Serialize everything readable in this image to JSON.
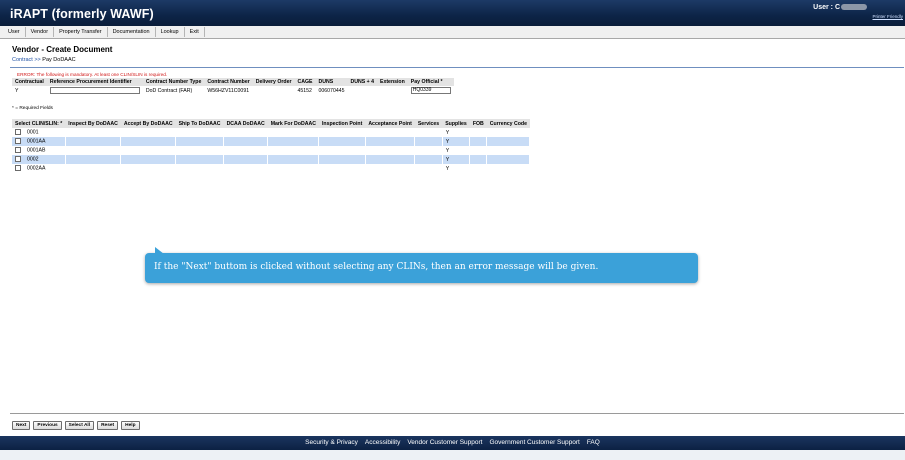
{
  "header": {
    "app_title": "iRAPT (formerly WAWF)",
    "user_label": "User : C",
    "printer_link": "Printer Friendly"
  },
  "menu": [
    {
      "label": "User"
    },
    {
      "label": "Vendor"
    },
    {
      "label": "Property Transfer"
    },
    {
      "label": "Documentation"
    },
    {
      "label": "Lookup"
    },
    {
      "label": "Exit"
    }
  ],
  "page": {
    "title": "Vendor - Create Document",
    "breadcrumb_link": "Contract",
    "breadcrumb_sep": " >> ",
    "breadcrumb_current": "Pay DoDAAC",
    "error": "ERROR: The following is mandatory. At least one CLIN/SLIN is required.",
    "required_note": "* = Required Fields"
  },
  "contract_table": {
    "headers": [
      "Contractual",
      "Reference Procurement Identifier",
      "Contract Number Type",
      "Contract Number",
      "Delivery Order",
      "CAGE",
      "DUNS",
      "DUNS + 4",
      "Extension",
      "Pay Official *"
    ],
    "row": {
      "contractual": "Y",
      "reference_procurement_identifier": "",
      "contract_number_type": "DoD Contract (FAR)",
      "contract_number": "W56HZV11C0091",
      "delivery_order": "",
      "cage": "45152",
      "duns": "006070445",
      "duns_plus4": "",
      "extension": "",
      "pay_official": "HQ0339"
    }
  },
  "clin_table": {
    "headers": [
      "Select CLIN/SLIN: *",
      "Inspect By DoDAAC",
      "Accept By DoDAAC",
      "Ship To DoDAAC",
      "DCAA DoDAAC",
      "Mark For DoDAAC",
      "Inspection Point",
      "Acceptance Point",
      "Services",
      "Supplies",
      "FOB",
      "Currency Code"
    ],
    "rows": [
      {
        "clin": "0001",
        "supplies": "Y"
      },
      {
        "clin": "0001AA",
        "supplies": "Y"
      },
      {
        "clin": "0001AB",
        "supplies": "Y"
      },
      {
        "clin": "0002",
        "supplies": "Y"
      },
      {
        "clin": "0002AA",
        "supplies": "Y"
      }
    ]
  },
  "tooltip": {
    "text": "If the \"Next\" buttom is clicked without selecting any CLINs, then an error message will be given."
  },
  "buttons": {
    "next": "Next",
    "previous": "Previous",
    "select_all": "Select All",
    "reset": "Reset",
    "help": "Help"
  },
  "footer": {
    "links": [
      "Security & Privacy",
      "Accessibility",
      "Vendor Customer Support",
      "Government Customer Support",
      "FAQ"
    ]
  },
  "colors": {
    "header_bg": "#0d2447",
    "alt_row": "#c8dcf6",
    "error": "#d01515",
    "tooltip_bg": "#3ba1d9"
  }
}
